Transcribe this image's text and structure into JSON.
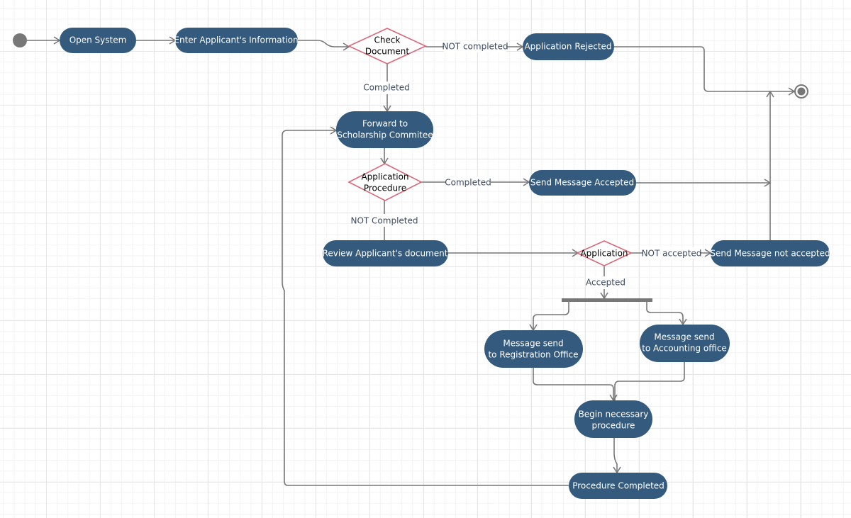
{
  "diagram": {
    "colors": {
      "action_fill": "#345b7d",
      "decision_stroke": "#d8687a",
      "edge": "#777777",
      "label": "#3c4a63"
    },
    "nodes": {
      "open_system": "Open System",
      "enter_info": "Enter Applicant's Information",
      "check_document": [
        "Check",
        "Document"
      ],
      "application_rejected": "Application Rejected",
      "forward": [
        "Forward to",
        "Scholarship Commitee"
      ],
      "application_procedure": [
        "Application",
        "Procedure"
      ],
      "send_accepted": "Send Message Accepted",
      "review": "Review Applicant's document",
      "application": "Application",
      "send_not_accepted": "Send Message not accepted",
      "registration": [
        "Message send",
        "to Registration Office"
      ],
      "accounting": [
        "Message send",
        "to Accounting office"
      ],
      "begin": [
        "Begin necessary",
        "procedure"
      ],
      "procedure_completed": "Procedure Completed"
    },
    "edge_labels": {
      "not_completed_1": "NOT completed",
      "completed_1": "Completed",
      "completed_2": "Completed",
      "not_completed_2": "NOT Completed",
      "not_accepted": "NOT accepted",
      "accepted": "Accepted"
    }
  }
}
